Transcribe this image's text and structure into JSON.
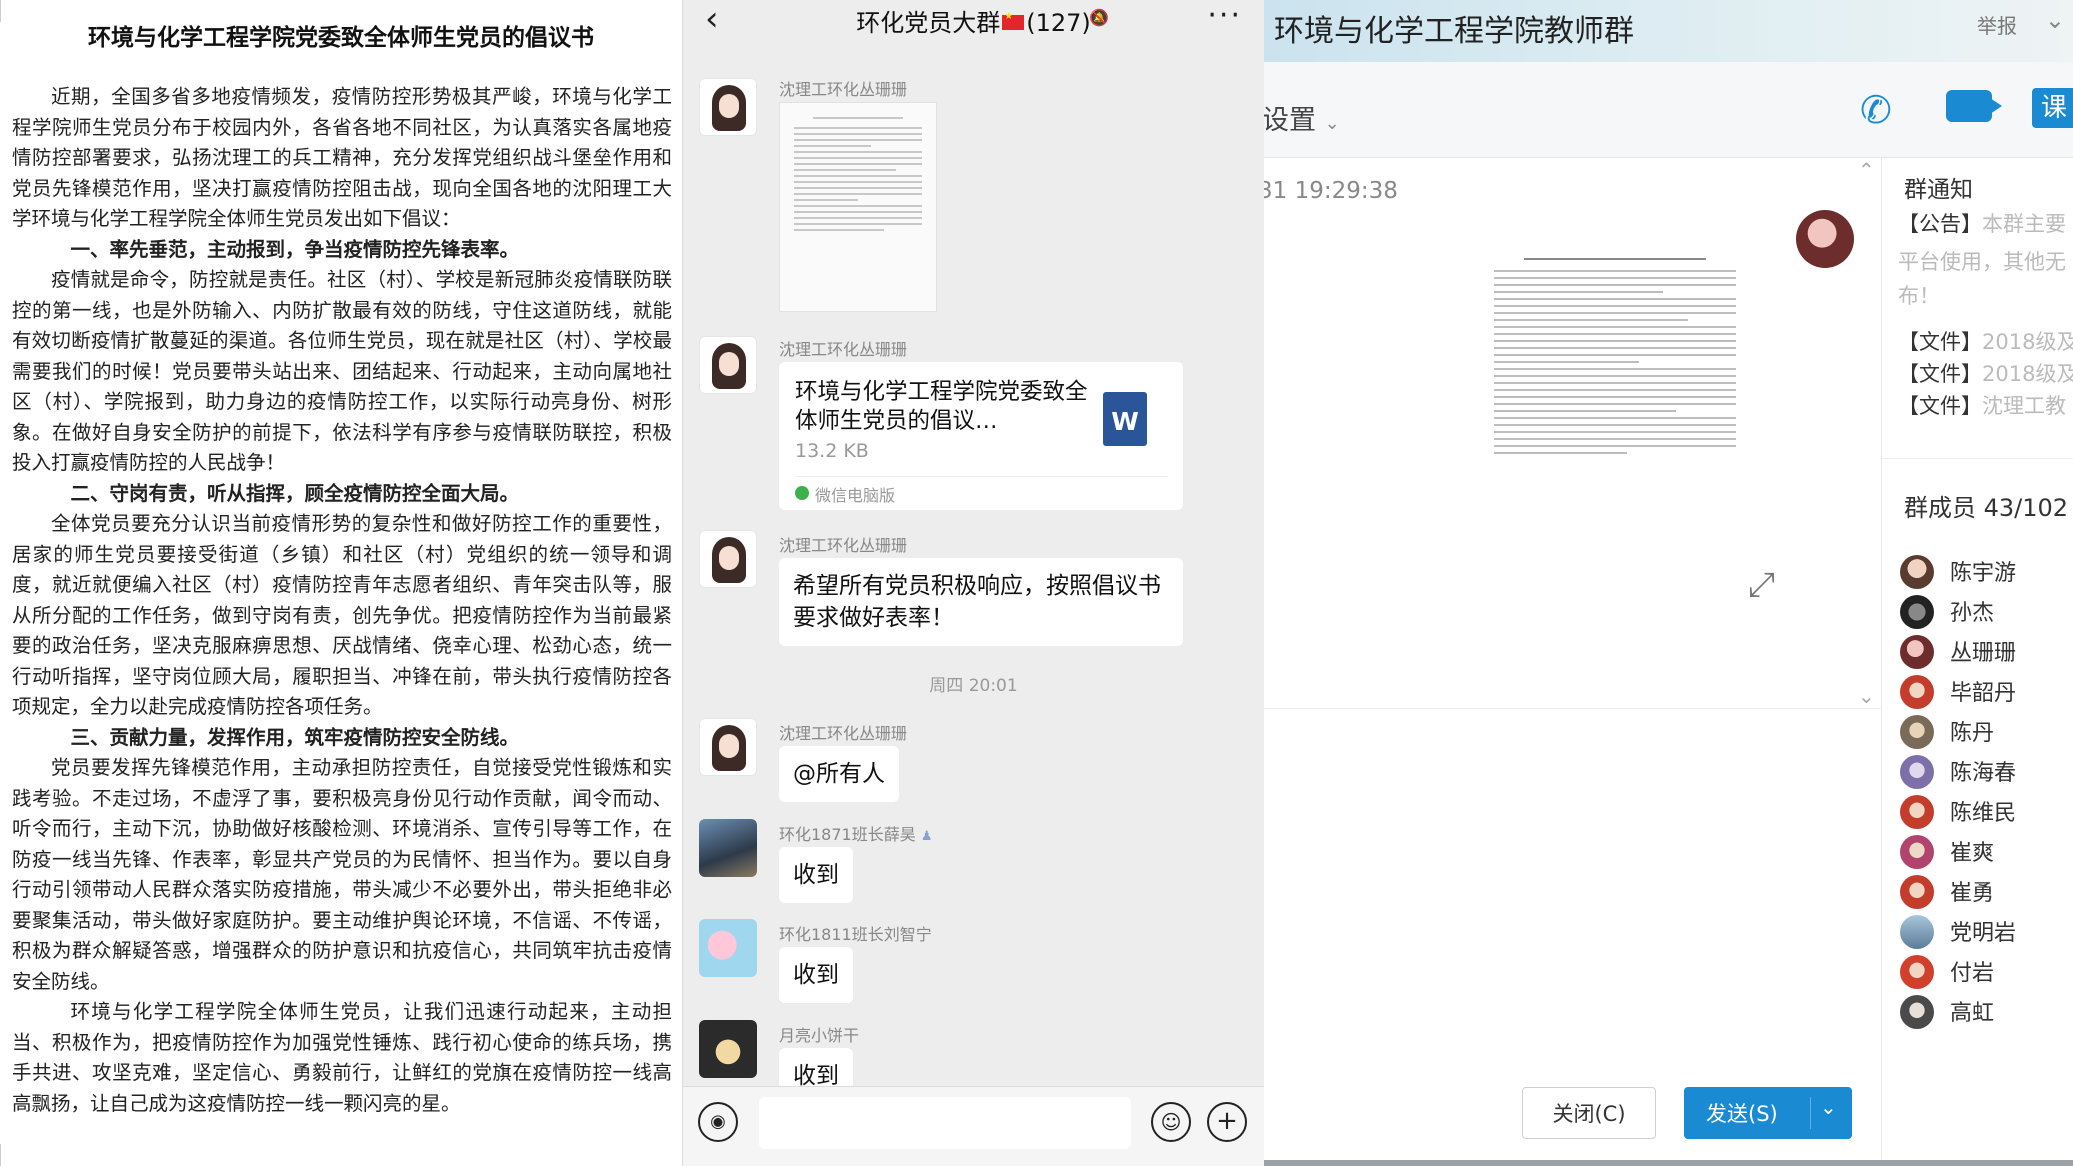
{
  "document": {
    "title": "环境与化学工程学院党委致全体师生党员的倡议书",
    "paragraphs": [
      {
        "type": "text",
        "text": "近期，全国多省多地疫情频发，疫情防控形势极其严峻，环境与化学工程学院师生党员分布于校园内外，各省各地不同社区，为认真落实各属地疫情防控部署要求，弘扬沈理工的兵工精神，充分发挥党组织战斗堡垒作用和党员先锋模范作用，坚决打赢疫情防控阻击战，现向全国各地的沈阳理工大学环境与化学工程学院全体师生党员发出如下倡议："
      },
      {
        "type": "head",
        "text": "一、率先垂范，主动报到，争当疫情防控先锋表率。"
      },
      {
        "type": "text",
        "text": "疫情就是命令，防控就是责任。社区（村）、学校是新冠肺炎疫情联防联控的第一线，也是外防输入、内防扩散最有效的防线，守住这道防线，就能有效切断疫情扩散蔓延的渠道。各位师生党员，现在就是社区（村）、学校最需要我们的时候！党员要带头站出来、团结起来、行动起来，主动向属地社区（村）、学院报到，助力身边的疫情防控工作，以实际行动亮身份、树形象。在做好自身安全防护的前提下，依法科学有序参与疫情联防联控，积极投入打赢疫情防控的人民战争！"
      },
      {
        "type": "head",
        "text": "二、守岗有责，听从指挥，顾全疫情防控全面大局。"
      },
      {
        "type": "text",
        "text": "全体党员要充分认识当前疫情形势的复杂性和做好防控工作的重要性，居家的师生党员要接受街道（乡镇）和社区（村）党组织的统一领导和调度，就近就便编入社区（村）疫情防控青年志愿者组织、青年突击队等，服从所分配的工作任务，做到守岗有责，创先争优。把疫情防控作为当前最紧要的政治任务，坚决克服麻痹思想、厌战情绪、侥幸心理、松劲心态，统一行动听指挥，坚守岗位顾大局，履职担当、冲锋在前，带头执行疫情防控各项规定，全力以赴完成疫情防控各项任务。"
      },
      {
        "type": "head",
        "text": "三、贡献力量，发挥作用，筑牢疫情防控安全防线。"
      },
      {
        "type": "text",
        "text": "党员要发挥先锋模范作用，主动承担防控责任，自觉接受党性锻炼和实践考验。不走过场，不虚浮了事，要积极亮身份见行动作贡献，闻令而动、听令而行，主动下沉，协助做好核酸检测、环境消杀、宣传引导等工作，在防疫一线当先锋、作表率，彰显共产党员的为民情怀、担当作为。要以自身行动引领带动人民群众落实防疫措施，带头减少不必要外出，带头拒绝非必要聚集活动，带头做好家庭防护。要主动维护舆论环境，不信谣、不传谣，积极为群众解疑答惑，增强群众的防护意识和抗疫信心，共同筑牢抗击疫情安全防线。"
      },
      {
        "type": "text",
        "text": "环境与化学工程学院全体师生党员，让我们迅速行动起来，主动担当、积极作为，把疫情防控作为加强党性锤炼、践行初心使命的练兵场，携手共进、攻坚克难，坚定信心、勇毅前行，让鲜红的党旗在疫情防控一线高高飘扬，让自己成为这疫情防控一线一颗闪亮的星。"
      }
    ]
  },
  "chat": {
    "title": "环化党员大群",
    "count": "(127)",
    "back_icon": "chevron-left-icon",
    "more_label": "···",
    "messages": [
      {
        "sender": "沈理工环化丛珊珊",
        "kind": "image"
      },
      {
        "sender": "沈理工环化丛珊珊",
        "kind": "file",
        "file_name": "环境与化学工程学院党委致全体师生党员的倡议…",
        "file_size": "13.2 KB",
        "file_source": "微信电脑版"
      },
      {
        "sender": "沈理工环化丛珊珊",
        "kind": "text",
        "text": "希望所有党员积极响应，按照倡议书要求做好表率！"
      },
      {
        "sender": "沈理工环化丛珊珊",
        "kind": "text",
        "text": "@所有人"
      },
      {
        "sender": "环化1871班长薛昊",
        "kind": "text",
        "text": "收到"
      },
      {
        "sender": "环化1811班长刘智宁",
        "kind": "text",
        "text": "收到"
      },
      {
        "sender": "月亮小饼干",
        "kind": "text",
        "text": "收到"
      }
    ],
    "time_separator": "周四 20:01"
  },
  "qq": {
    "group_title": "环境与化学工程学院教师群",
    "report_label": "举报",
    "settings_label": "设置",
    "lesson_label": "课",
    "timestamp": "31 19:29:38",
    "close_button": "关闭(C)",
    "send_button": "发送(S)",
    "notice_title": "群通知",
    "notices": [
      {
        "prefix": "【公告】",
        "text": "本群主要"
      },
      {
        "prefix": "",
        "text": "平台使用，其他无"
      },
      {
        "prefix": "",
        "text": "布！"
      },
      {
        "prefix": "【文件】",
        "text": "2018级及"
      },
      {
        "prefix": "【文件】",
        "text": "2018级及"
      },
      {
        "prefix": "【文件】",
        "text": "沈理工教"
      }
    ],
    "members_title": "群成员 43/102",
    "members": [
      "陈宇游",
      "孙杰",
      "丛珊珊",
      "毕韶丹",
      "陈丹",
      "陈海春",
      "陈维民",
      "崔爽",
      "崔勇",
      "党明岩",
      "付岩",
      "高虹"
    ]
  }
}
